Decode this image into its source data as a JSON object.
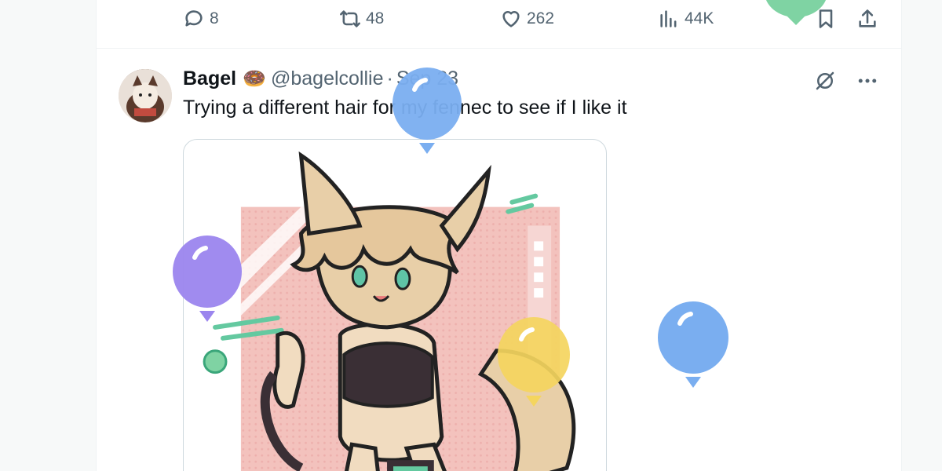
{
  "prev_tweet_actions": {
    "replies": "8",
    "retweets": "48",
    "likes": "262",
    "views": "44K"
  },
  "tweet": {
    "display_name": "Bagel",
    "emoji": "🍩",
    "handle": "@bagelcollie",
    "separator": "·",
    "date": "Sep 23",
    "text": "Trying a different hair for my fennec to see if I like it"
  },
  "colors": {
    "muted": "#536471",
    "border": "#cfd9de",
    "balloon_blue": "#7aaef0",
    "balloon_purple": "#9b85ee",
    "balloon_yellow": "#f4d55e",
    "balloon_green": "#7fd3a3"
  }
}
